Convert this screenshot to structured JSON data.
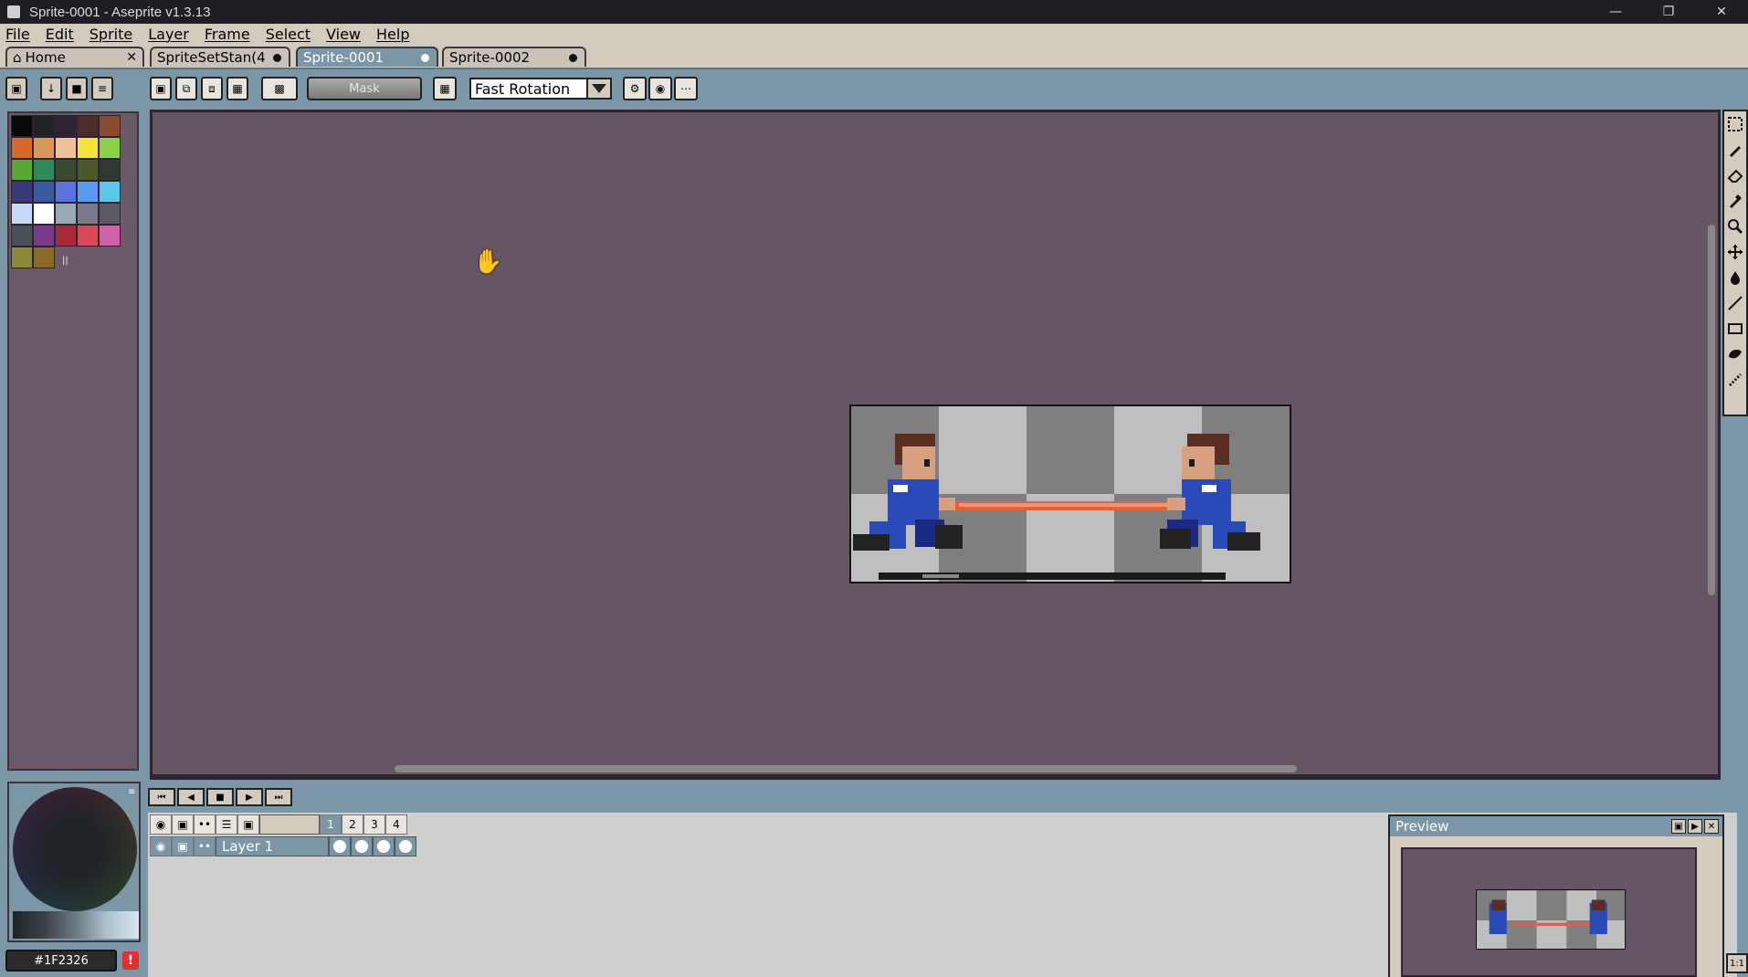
{
  "window": {
    "title": "Sprite-0001 - Aseprite v1.3.13"
  },
  "menu": [
    "File",
    "Edit",
    "Sprite",
    "Layer",
    "Frame",
    "Select",
    "View",
    "Help"
  ],
  "tabs": [
    {
      "label": "Home",
      "active": false
    },
    {
      "label": "SpriteSetStan(4",
      "active": false
    },
    {
      "label": "Sprite-0001",
      "active": true
    },
    {
      "label": "Sprite-0002",
      "active": false
    }
  ],
  "context_bar": {
    "mask_label": "Mask",
    "rotation_algorithm": "Fast Rotation"
  },
  "palette": {
    "colors": [
      "#0a0a0a",
      "#1f2326",
      "#2e2235",
      "#4a2c2a",
      "#8a4a30",
      "#d66a2a",
      "#d89a5c",
      "#eec39a",
      "#f2e23a",
      "#8ad048",
      "#58a832",
      "#2e8a58",
      "#3a4a2e",
      "#4a5a2a",
      "#2e3a30",
      "#3a3a7a",
      "#3a5aa0",
      "#5a72e0",
      "#5a9af0",
      "#5ac8e8",
      "#c8d8f8",
      "#ffffff",
      "#9aa8b8",
      "#7a7a8a",
      "#5a5a62",
      "#4a5058",
      "#7a3a8a",
      "#a82a3a",
      "#d84a5a",
      "#d060a8",
      "#8a8a3a",
      "#8a6a2a"
    ]
  },
  "timeline": {
    "frames": [
      "1",
      "2",
      "3",
      "4"
    ],
    "layers": [
      {
        "name": "Layer 1"
      }
    ]
  },
  "preview": {
    "title": "Preview"
  },
  "color": {
    "fg_hex": "#1F2326"
  }
}
